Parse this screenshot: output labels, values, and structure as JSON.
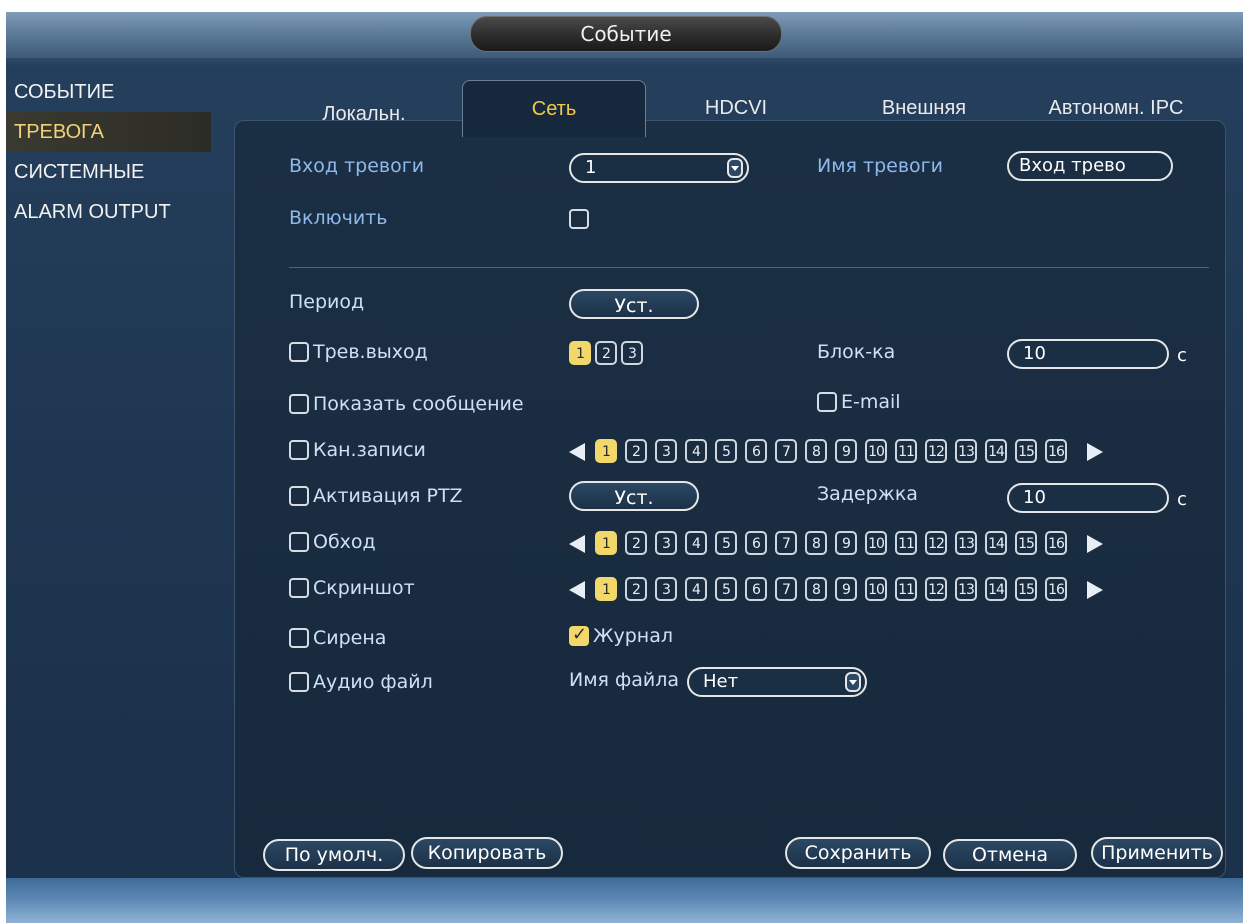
{
  "window": {
    "title": "Событие"
  },
  "sidebar": {
    "items": [
      {
        "label": "СОБЫТИЕ",
        "active": false
      },
      {
        "label": "ТРЕВОГА",
        "active": true
      },
      {
        "label": "СИСТЕМНЫЕ",
        "active": false
      },
      {
        "label": "ALARM OUTPUT",
        "active": false
      }
    ]
  },
  "tabs": [
    {
      "label": "Локальн.",
      "active": false
    },
    {
      "label": "Сеть",
      "active": true
    },
    {
      "label": "HDCVI",
      "active": false
    },
    {
      "label": "Внешняя",
      "active": false
    },
    {
      "label": "Автономн. IPC",
      "active": false
    }
  ],
  "form": {
    "alarm_input": {
      "label": "Вход тревоги",
      "value": "1"
    },
    "alarm_name": {
      "label": "Имя тревоги",
      "value": "Вход трево"
    },
    "enable": {
      "label": "Включить",
      "checked": false
    },
    "period": {
      "label": "Период",
      "button": "Уст."
    },
    "alarm_out": {
      "label": "Трев.выход",
      "checked": false,
      "channels": [
        "1",
        "2",
        "3"
      ],
      "selected": "1"
    },
    "latch": {
      "label": "Блок-ка",
      "value": "10",
      "unit": "с"
    },
    "show_message": {
      "label": "Показать сообщение",
      "checked": false
    },
    "email": {
      "label": "E-mail",
      "checked": false
    },
    "record_channel": {
      "label": "Кан.записи",
      "checked": false
    },
    "ptz": {
      "label": "Активация PTZ",
      "checked": false,
      "button": "Уст."
    },
    "delay": {
      "label": "Задержка",
      "value": "10",
      "unit": "с"
    },
    "tour": {
      "label": "Обход",
      "checked": false
    },
    "snapshot": {
      "label": "Скриншот",
      "checked": false
    },
    "siren": {
      "label": "Сирена",
      "checked": false
    },
    "log": {
      "label": "Журнал",
      "checked": true
    },
    "audio_file": {
      "label": "Аудио файл",
      "checked": false
    },
    "file_name": {
      "label": "Имя файла",
      "value": "Нет"
    }
  },
  "channels_16": [
    "1",
    "2",
    "3",
    "4",
    "5",
    "6",
    "7",
    "8",
    "9",
    "10",
    "11",
    "12",
    "13",
    "14",
    "15",
    "16"
  ],
  "footer": {
    "default": "По умолч.",
    "copy": "Копировать",
    "save": "Сохранить",
    "cancel": "Отмена",
    "apply": "Применить"
  },
  "colors": {
    "accent_yellow": "#f2d86b",
    "active_tab_text": "#f5c84a",
    "label_blue": "#8fb9ea",
    "panel_bg": "#1b2f44"
  },
  "icons": {
    "dropdown": "chevron-down-icon",
    "prev": "arrow-left-icon",
    "next": "arrow-right-icon",
    "checkbox": "checkbox-icon"
  }
}
